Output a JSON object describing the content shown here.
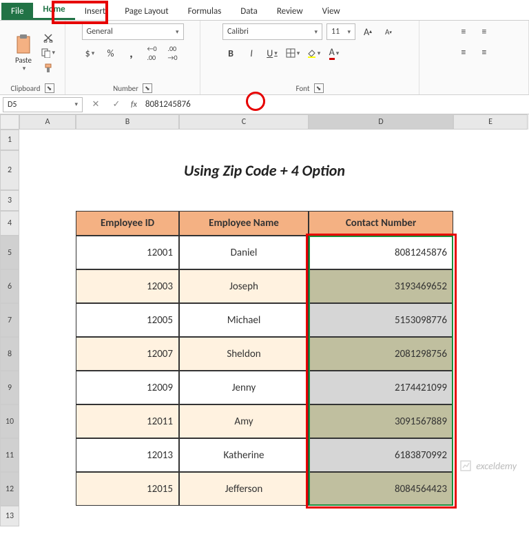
{
  "tabs": [
    "File",
    "Home",
    "Insert",
    "Page Layout",
    "Formulas",
    "Data",
    "Review",
    "View"
  ],
  "activeTab": "Home",
  "clipboard": {
    "paste": "Paste",
    "label": "Clipboard"
  },
  "number": {
    "format": "General",
    "label": "Number"
  },
  "font": {
    "name": "Calibri",
    "size": "11",
    "label": "Font"
  },
  "namebox": "D5",
  "formula": "8081245876",
  "cols": [
    "A",
    "B",
    "C",
    "D",
    "E"
  ],
  "title": "Using Zip Code + 4 Option",
  "headers": {
    "b": "Employee ID",
    "c": "Employee Name",
    "d": "Contact Number"
  },
  "rows": [
    {
      "r": "5",
      "id": "12001",
      "name": "Daniel",
      "contact": "8081245876"
    },
    {
      "r": "6",
      "id": "12003",
      "name": "Joseph",
      "contact": "3193469652"
    },
    {
      "r": "7",
      "id": "12005",
      "name": "Michael",
      "contact": "5153098776"
    },
    {
      "r": "8",
      "id": "12007",
      "name": "Sheldon",
      "contact": "2081298756"
    },
    {
      "r": "9",
      "id": "12009",
      "name": "Jenny",
      "contact": "2174421099"
    },
    {
      "r": "10",
      "id": "12011",
      "name": "Amy",
      "contact": "3091567889"
    },
    {
      "r": "11",
      "id": "12013",
      "name": "Katherine",
      "contact": "6183870992"
    },
    {
      "r": "12",
      "id": "12015",
      "name": "Jefferson",
      "contact": "8084564423"
    }
  ],
  "watermark": "exceldemy"
}
